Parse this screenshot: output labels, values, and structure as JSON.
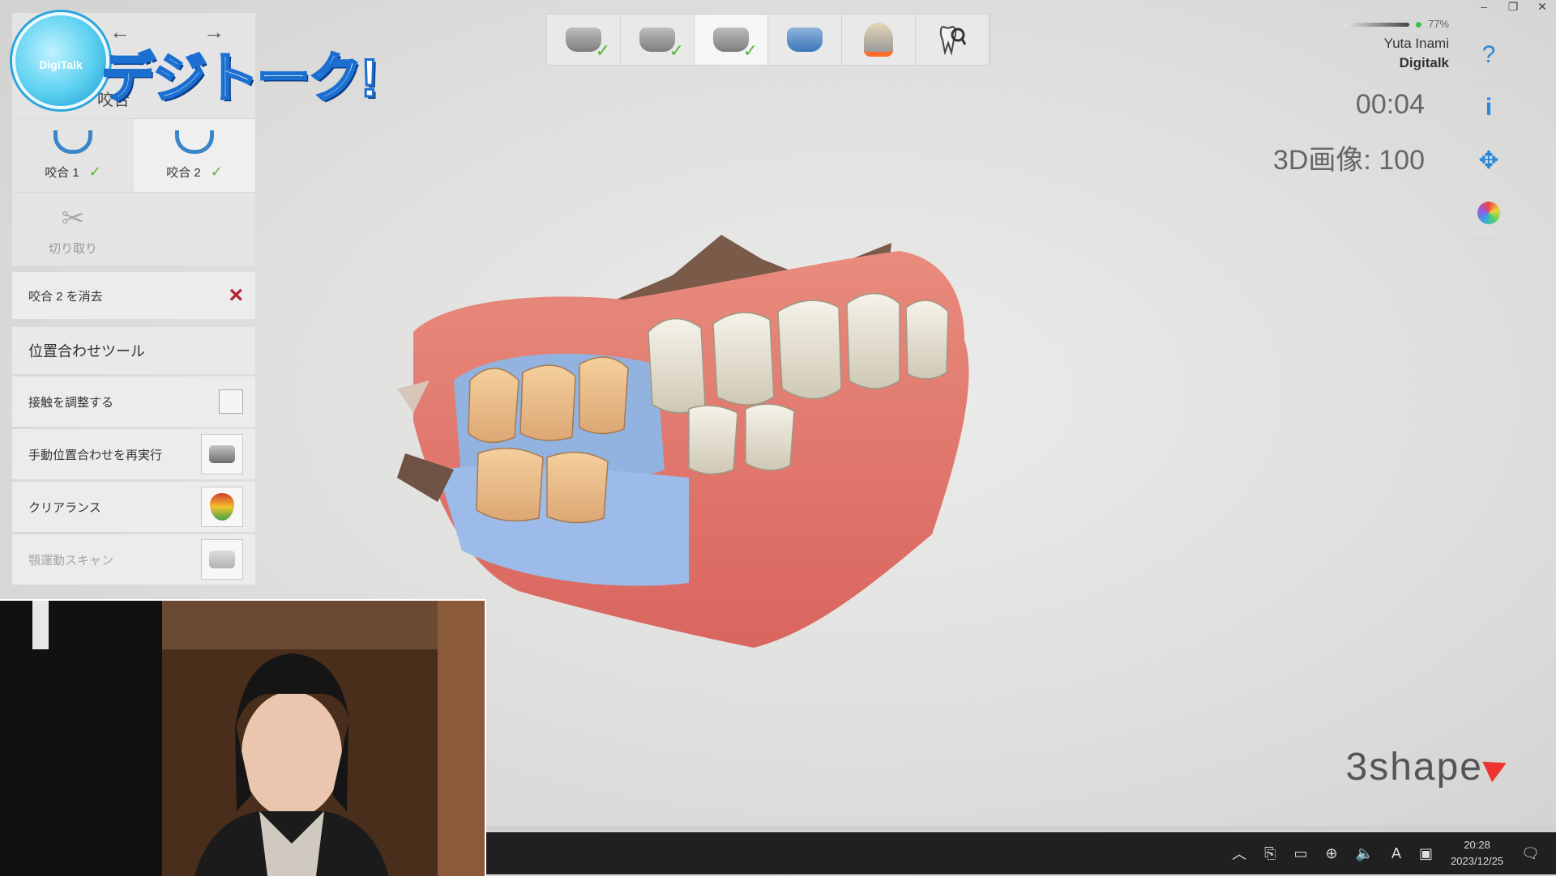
{
  "logo": {
    "small_text": "DigiTalk",
    "title_text": "デジトーク!"
  },
  "nav": {
    "back": "←",
    "forward": "→"
  },
  "panel": {
    "title": "咬合",
    "scans": [
      {
        "label": "咬合 1",
        "check": "✓"
      },
      {
        "label": "咬合 2",
        "check": "✓"
      },
      {
        "label": "切り取り"
      }
    ],
    "delete_row": {
      "label": "咬合 2 を消去",
      "icon": "×"
    },
    "tools_title": "位置合わせツール",
    "tools": [
      {
        "label": "接触を調整する"
      },
      {
        "label": "手動位置合わせを再実行"
      },
      {
        "label": "クリアランス"
      },
      {
        "label": "顎運動スキャン"
      }
    ]
  },
  "steps": [
    {
      "name": "upper-jaw",
      "check": "✓"
    },
    {
      "name": "lower-jaw",
      "check": "✓"
    },
    {
      "name": "bite",
      "check": "✓"
    },
    {
      "name": "bite-blue"
    },
    {
      "name": "clearance"
    },
    {
      "name": "tooth-inspect"
    }
  ],
  "user": {
    "battery": "77%",
    "name": "Yuta Inami",
    "org": "Digitalk"
  },
  "timer": "00:04",
  "image_count": "3D画像: 100",
  "right_tools": {
    "help": "?",
    "info": "i",
    "move": "✥"
  },
  "brand": "3shape",
  "taskbar": {
    "time": "20:28",
    "date": "2023/12/25",
    "ime": "A"
  }
}
